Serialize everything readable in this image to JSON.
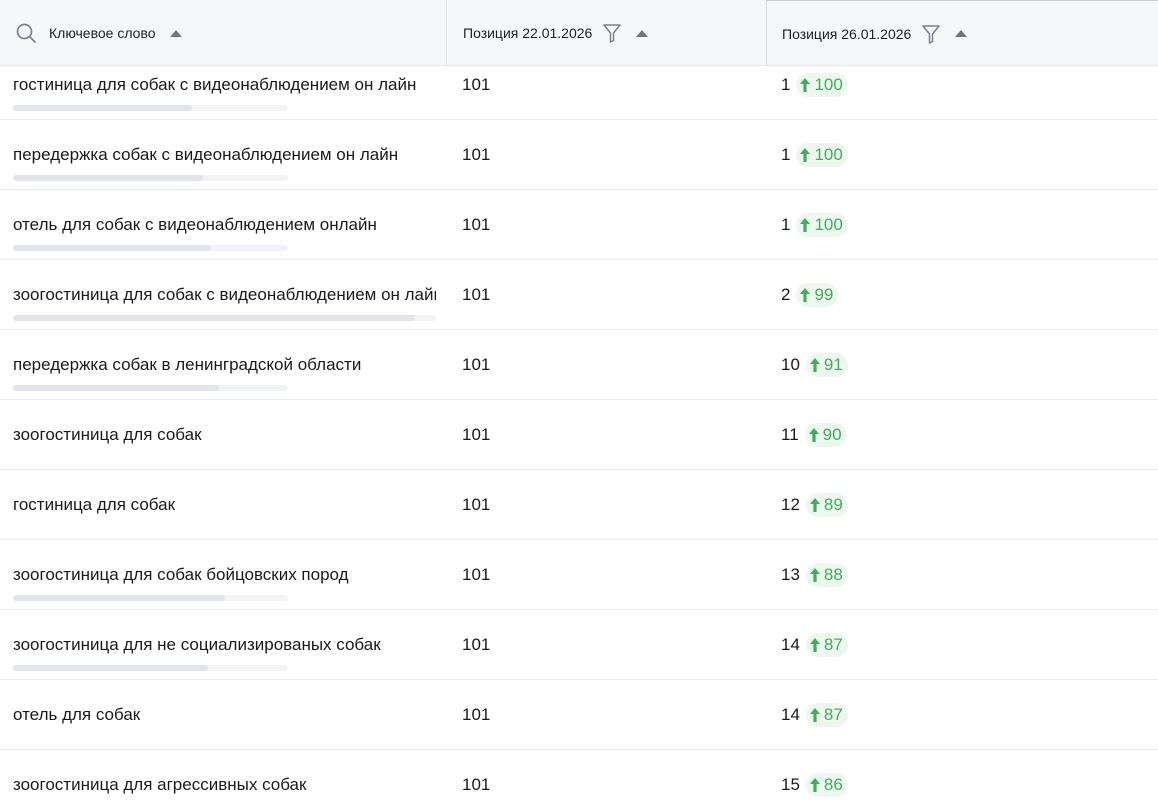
{
  "header": {
    "keyword_label": "Ключевое слово",
    "pos_date1_label": "Позиция 22.01.2026",
    "pos_date2_label": "Позиция 26.01.2026"
  },
  "colors": {
    "header_bg": "#f6f7f9",
    "delta_green": "#3fae5a",
    "delta_bg": "#eef7ef",
    "bar_fill": "#e1e5eb"
  },
  "rows": [
    {
      "keyword": "гостиница для собак с видеонаблюдением он лайн",
      "pos1": "101",
      "pos2": "1",
      "delta": "100",
      "bar_fraction": 0.65
    },
    {
      "keyword": "передержка собак с видеонаблюдением он лайн",
      "pos1": "101",
      "pos2": "1",
      "delta": "100",
      "bar_fraction": 0.69
    },
    {
      "keyword": "отель для собак с видеонаблюдением онлайн",
      "pos1": "101",
      "pos2": "1",
      "delta": "100",
      "bar_fraction": 0.72
    },
    {
      "keyword": "зоогостиница для собак с видеонаблюдением он лайн",
      "pos1": "101",
      "pos2": "2",
      "delta": "99",
      "bar_fraction": 0.95
    },
    {
      "keyword": "передержка собак в ленинградской области",
      "pos1": "101",
      "pos2": "10",
      "delta": "91",
      "bar_fraction": 0.75
    },
    {
      "keyword": "зоогостиница для собак",
      "pos1": "101",
      "pos2": "11",
      "delta": "90",
      "bar_fraction": null
    },
    {
      "keyword": "гостиница для собак",
      "pos1": "101",
      "pos2": "12",
      "delta": "89",
      "bar_fraction": null
    },
    {
      "keyword": "зоогостиница для собак бойцовских пород",
      "pos1": "101",
      "pos2": "13",
      "delta": "88",
      "bar_fraction": 0.77
    },
    {
      "keyword": "зоогостиница для не социализированых собак",
      "pos1": "101",
      "pos2": "14",
      "delta": "87",
      "bar_fraction": 0.71
    },
    {
      "keyword": "отель для собак",
      "pos1": "101",
      "pos2": "14",
      "delta": "87",
      "bar_fraction": null
    },
    {
      "keyword": "зоогостиница для агрессивных собак",
      "pos1": "101",
      "pos2": "15",
      "delta": "86",
      "bar_fraction": null
    }
  ]
}
